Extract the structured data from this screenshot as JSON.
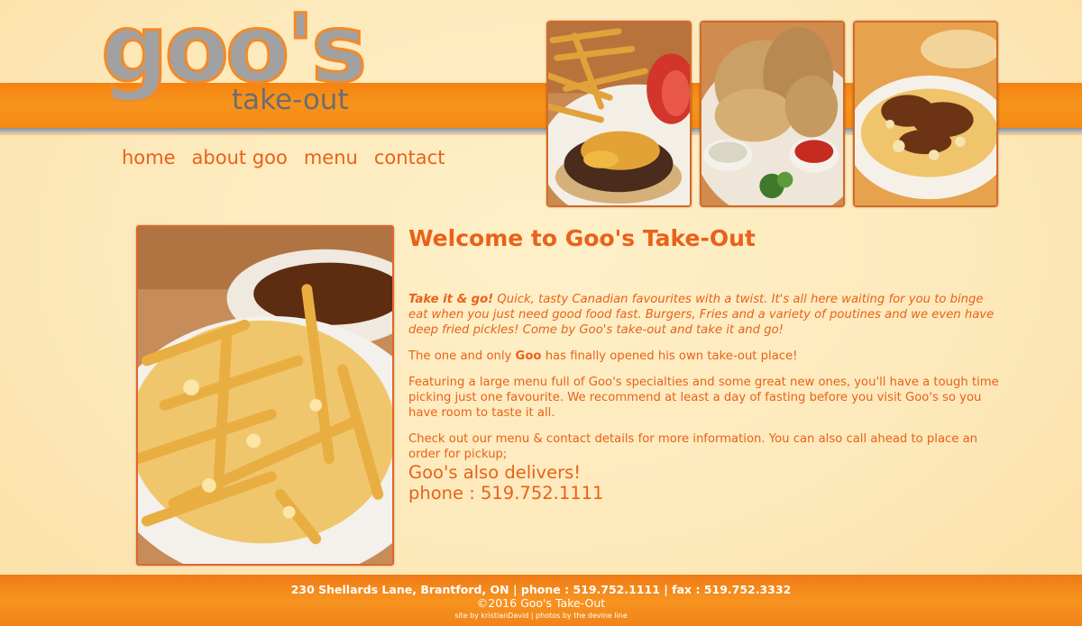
{
  "brand": {
    "logo_word": "goo's",
    "logo_sub": "take-out"
  },
  "nav": {
    "items": [
      "home",
      "about goo",
      "menu",
      "contact"
    ]
  },
  "photos": {
    "header": [
      "burger-fries-photo",
      "fried-fish-photo",
      "poutine-photo"
    ],
    "main": "fries-poutine-photo"
  },
  "content": {
    "title": "Welcome to Goo's Take-Out",
    "intro_lead": "Take it & go!",
    "intro_text": " Quick, tasty Canadian favourites with a twist. It's all here waiting for you to binge eat when you just need good food fast. Burgers, Fries and a variety of poutines and we even have deep fried pickles! Come by Goo's take-out and take it and go!",
    "p1_a": "The one and only ",
    "p1_bold": "Goo",
    "p1_b": " has finally opened his own take-out place!",
    "p2": "Featuring a large menu full of Goo's specialties and some great new ones, you'll have a tough time picking just one favourite. We recommend at least a day of fasting before you visit Goo's so you have room to taste it all.",
    "p3": "Check out our menu & contact details for more information. You can also call ahead to place an order for pickup;",
    "delivers": "Goo's also delivers!",
    "phone": "phone : 519.752.1111"
  },
  "footer": {
    "address": "230 Shellards Lane, Brantford, ON | phone : 519.752.1111 | fax : 519.752.3332",
    "copyright": "©2016 Goo's Take-Out",
    "credits": "site by kristianDavid | photos by the devine line"
  },
  "colors": {
    "accent": "#e8621a",
    "band": "#f7941d",
    "background": "#fde7b6",
    "logo_grey": "#a1a1a1"
  }
}
